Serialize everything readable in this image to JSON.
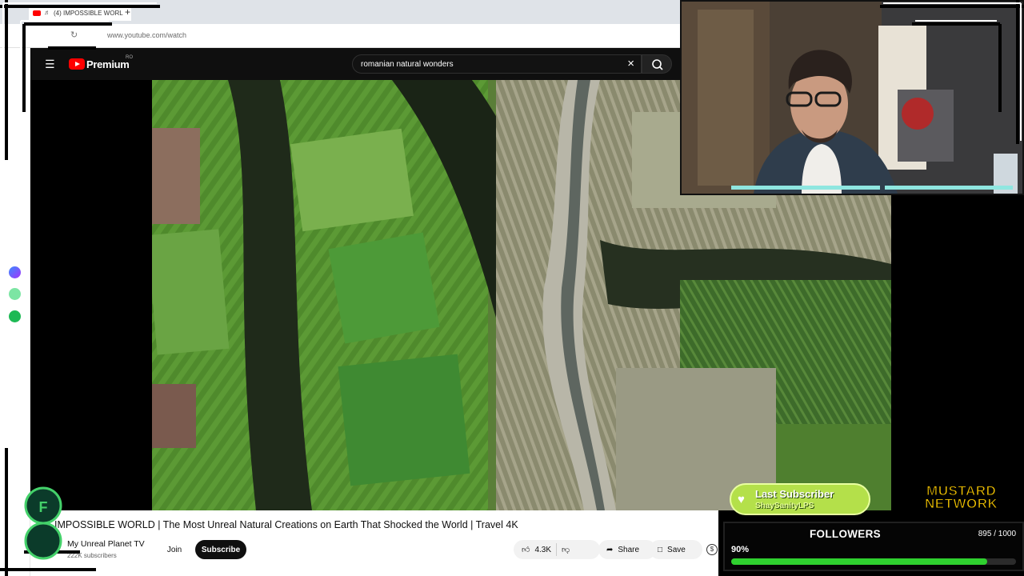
{
  "browser": {
    "tab_title": "(4) IMPOSSIBLE WORL",
    "url": "www.youtube.com/watch"
  },
  "youtube": {
    "brand": "Premium",
    "brand_region": "RO",
    "search_query": "romanian natural wonders"
  },
  "video": {
    "title": "IMPOSSIBLE WORLD | The Most Unreal Natural Creations on Earth That Shocked the World | Travel 4K",
    "channel": "My Unreal Planet TV",
    "subscribers": "222K subscribers",
    "join_label": "Join",
    "subscribe_label": "Subscribe",
    "likes": "4.3K",
    "share_label": "Share",
    "save_label": "Save"
  },
  "overlay": {
    "last_subscriber_title": "Last Subscriber",
    "last_subscriber_name": "ShaySanityLPS",
    "brand_line1": "MUSTARD",
    "brand_line2": "NETWORK",
    "followers_title": "FOLLOWERS",
    "followers_count": "895 / 1000",
    "followers_percent_label": "90%",
    "followers_progress": 0.9
  },
  "colors": {
    "youtube_red": "#ff0000",
    "overlay_green": "#2fd12f",
    "mustard_yellow": "#f4c400"
  }
}
